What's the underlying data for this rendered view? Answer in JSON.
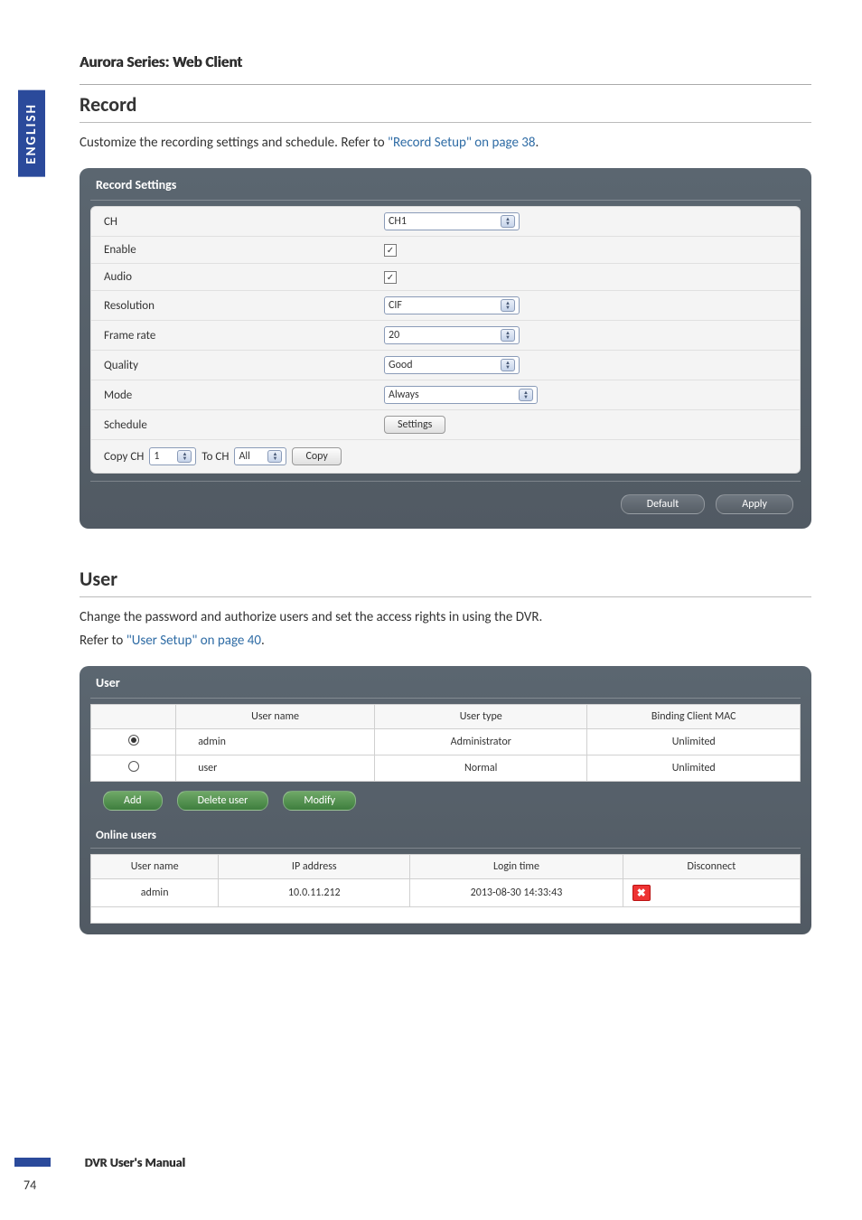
{
  "side_tab": "ENGLISH",
  "doc_header": "Aurora Series: Web Client",
  "record": {
    "heading": "Record",
    "desc_pre": "Customize the recording settings and schedule. Refer to ",
    "desc_link": "\"Record Setup\" on page 38",
    "desc_post": ".",
    "panel_title": "Record Settings",
    "rows": {
      "ch_label": "CH",
      "ch_value": "CH1",
      "enable_label": "Enable",
      "audio_label": "Audio",
      "resolution_label": "Resolution",
      "resolution_value": "CIF",
      "framerate_label": "Frame rate",
      "framerate_value": "20",
      "quality_label": "Quality",
      "quality_value": "Good",
      "mode_label": "Mode",
      "mode_value": "Always",
      "schedule_label": "Schedule",
      "schedule_btn": "Settings"
    },
    "copy": {
      "copy_ch_label": "Copy CH",
      "copy_ch_value": "1",
      "to_ch_label": "To CH",
      "to_ch_value": "All",
      "copy_btn": "Copy"
    },
    "default_btn": "Default",
    "apply_btn": "Apply"
  },
  "user": {
    "heading": "User",
    "desc1": "Change the password and authorize users and set the access rights in using the DVR.",
    "desc2_pre": "Refer to ",
    "desc2_link": "\"User Setup\" on page 40",
    "desc2_post": ".",
    "panel_title": "User",
    "table": {
      "headers": {
        "col1": "",
        "col2": "User name",
        "col3": "User type",
        "col4": "Binding Client MAC"
      },
      "rows": [
        {
          "selected": true,
          "username": "admin",
          "usertype": "Administrator",
          "mac": "Unlimited"
        },
        {
          "selected": false,
          "username": "user",
          "usertype": "Normal",
          "mac": "Unlimited"
        }
      ]
    },
    "btns": {
      "add": "Add",
      "delete": "Delete user",
      "modify": "Modify"
    },
    "online_title": "Online users",
    "online_table": {
      "headers": {
        "c1": "User name",
        "c2": "IP address",
        "c3": "Login time",
        "c4": "Disconnect"
      },
      "rows": [
        {
          "username": "admin",
          "ip": "10.0.11.212",
          "login": "2013-08-30 14:33:43"
        }
      ]
    }
  },
  "footer": {
    "text": "DVR User's Manual",
    "page": "74"
  }
}
